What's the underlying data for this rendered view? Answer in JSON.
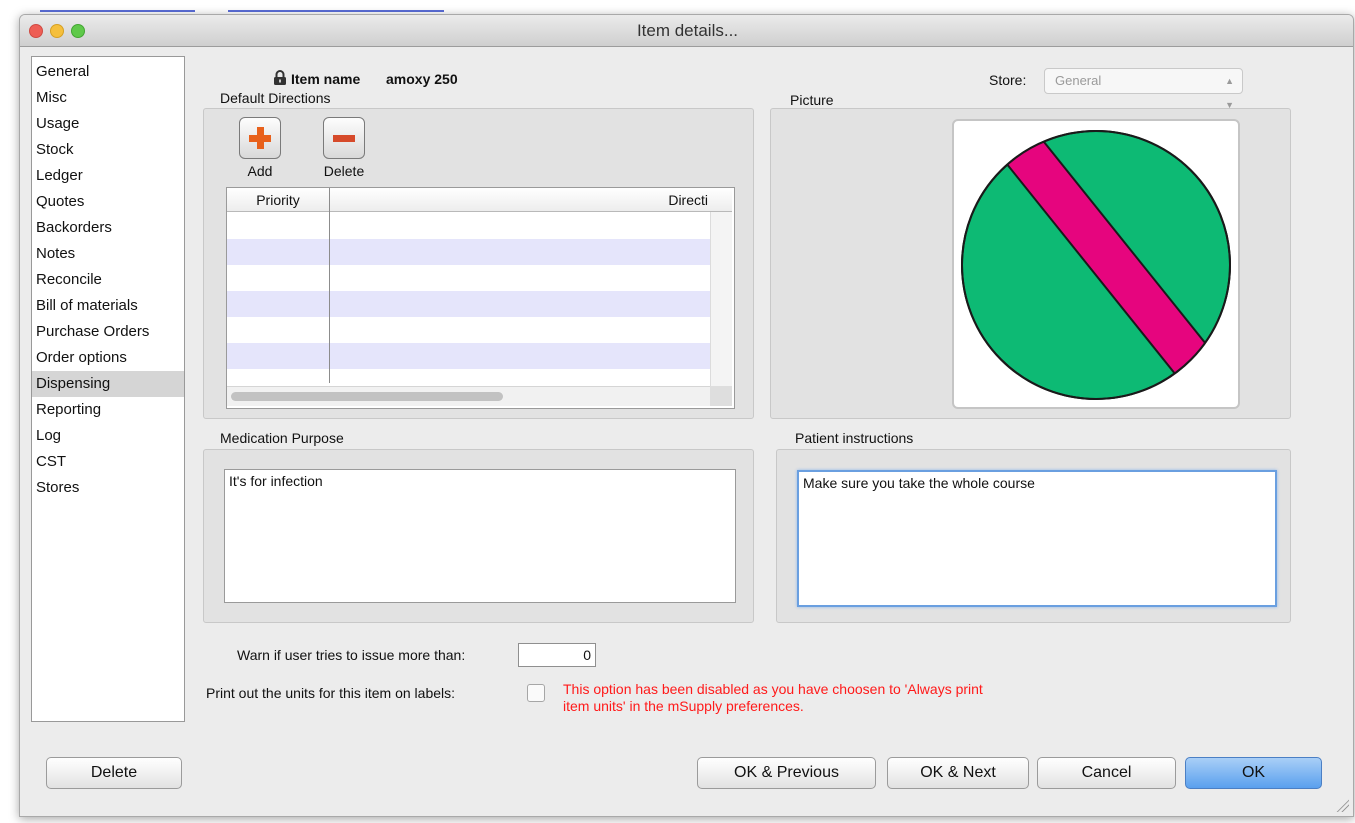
{
  "window": {
    "title": "Item details..."
  },
  "sidebar": {
    "items": [
      {
        "label": "General"
      },
      {
        "label": "Misc"
      },
      {
        "label": "Usage"
      },
      {
        "label": "Stock"
      },
      {
        "label": "Ledger"
      },
      {
        "label": "Quotes"
      },
      {
        "label": "Backorders"
      },
      {
        "label": "Notes"
      },
      {
        "label": "Reconcile"
      },
      {
        "label": "Bill of materials"
      },
      {
        "label": "Purchase Orders"
      },
      {
        "label": "Order options"
      },
      {
        "label": "Dispensing",
        "selected": true
      },
      {
        "label": "Reporting"
      },
      {
        "label": "Log"
      },
      {
        "label": "CST"
      },
      {
        "label": "Stores"
      }
    ]
  },
  "item": {
    "name_label": "Item name",
    "name_value": "amoxy 250",
    "lock_icon": "lock-icon"
  },
  "store": {
    "label": "Store:",
    "value": "General"
  },
  "default_directions": {
    "label": "Default Directions",
    "add_label": "Add",
    "delete_label": "Delete",
    "add_icon": "plus-icon",
    "delete_icon": "minus-icon",
    "columns": [
      "Priority",
      "Directi"
    ],
    "rows": []
  },
  "picture": {
    "label": "Picture",
    "colors": {
      "circle": "#0dba74",
      "stripe": "#e6057e"
    }
  },
  "medication_purpose": {
    "label": "Medication Purpose",
    "value": "It's for infection"
  },
  "patient_instructions": {
    "label": "Patient instructions",
    "value": "Make sure you take the whole course"
  },
  "warn": {
    "label": "Warn if user tries to issue more than:",
    "value": "0"
  },
  "print_units": {
    "label": "Print out the units for this item on labels:",
    "checked": false,
    "message_line1": "This option has been disabled as you have choosen to 'Always print",
    "message_line2": "item units' in the mSupply preferences."
  },
  "buttons": {
    "delete": "Delete",
    "ok_previous": "OK & Previous",
    "ok_next": "OK & Next",
    "cancel": "Cancel",
    "ok": "OK"
  },
  "colors": {
    "selection": "#d5d5d5",
    "alt_row": "#e5e5fb",
    "warning": "#ff1a1a",
    "default_button": "#5aa0ee"
  }
}
